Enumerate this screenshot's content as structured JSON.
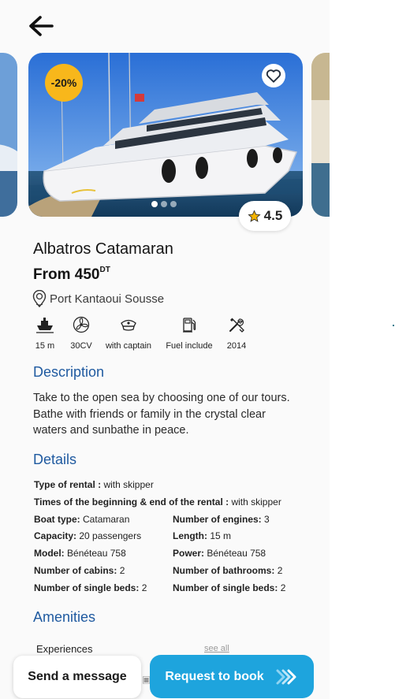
{
  "colors": {
    "accent": "#1ea4dd",
    "section_title": "#1f5aa0",
    "discount_badge": "#f8b71b",
    "star": "#f4b400"
  },
  "header": {
    "back_icon": "arrow-left-icon"
  },
  "carousel": {
    "discount": "-20%",
    "favorite_icon": "heart-outline-icon",
    "dots_total": 3,
    "dot_active": 1,
    "rating": "4.5"
  },
  "boat": {
    "name": "Albatros Catamaran",
    "price_prefix": "From 450",
    "price_currency": "DT",
    "location": "Port Kantaoui Sousse"
  },
  "features": [
    {
      "icon": "boat-length-icon",
      "label": "15 m"
    },
    {
      "icon": "engine-fan-icon",
      "label": "30CV"
    },
    {
      "icon": "captain-hat-icon",
      "label": "with captain"
    },
    {
      "icon": "fuel-pump-icon",
      "label": "Fuel include"
    },
    {
      "icon": "tools-icon",
      "label": "2014"
    }
  ],
  "description": {
    "title": "Description",
    "text": "Take to the open sea by choosing one of our tours. Bathe with friends or family in the crystal clear waters and sunbathe in peace."
  },
  "details": {
    "title": "Details",
    "type_of_rental": {
      "label": "Type of rental :",
      "value": "with skipper"
    },
    "times": {
      "label": "Times of the beginning & end of the rental :",
      "value": "with skipper"
    },
    "boat_type": {
      "label": "Boat type:",
      "value": "Catamaran"
    },
    "engines": {
      "label": "Number of engines:",
      "value": "3"
    },
    "capacity": {
      "label": "Capacity:",
      "value": "20 passengers"
    },
    "length": {
      "label": "Length:",
      "value": "15 m"
    },
    "model": {
      "label": "Model:",
      "value": "Bénéteau 758"
    },
    "power": {
      "label": "Power:",
      "value": "Bénéteau 758"
    },
    "cabins": {
      "label": "Number of cabins:",
      "value": "2"
    },
    "bathrooms": {
      "label": "Number of bathrooms:",
      "value": "2"
    },
    "single_beds_left": {
      "label": "Number of single beds:",
      "value": "2"
    },
    "single_beds_right": {
      "label": "Number of single beds:",
      "value": "2"
    }
  },
  "amenities": {
    "title": "Amenities",
    "first_label": "Experiences",
    "see_all": "see all"
  },
  "actions": {
    "send_message": "Send a message",
    "request_to_book": "Request to book",
    "book_icon": "double-chevron-right-icon"
  }
}
